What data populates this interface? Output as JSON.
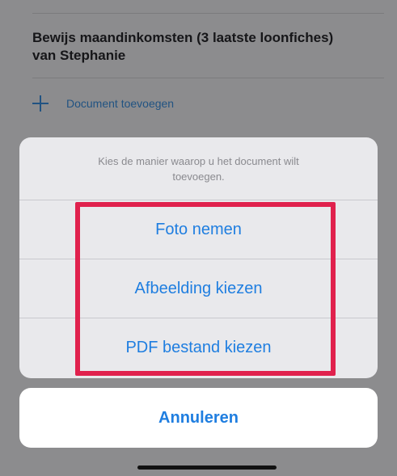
{
  "background": {
    "document_title": "Bewijs maandinkomsten (3 laatste loonfiches) van Stephanie",
    "add_document_label": "Document toevoegen"
  },
  "action_sheet": {
    "message": "Kies de manier waarop u het document wilt toevoegen.",
    "options": [
      {
        "label": "Foto nemen"
      },
      {
        "label": "Afbeelding kiezen"
      },
      {
        "label": "PDF bestand kiezen"
      }
    ],
    "cancel_label": "Annuleren"
  },
  "colors": {
    "accent": "#1f7ee0",
    "highlight": "#e0214d",
    "overlay": "#8e8e8e"
  },
  "icons": {
    "add": "plus-icon"
  }
}
